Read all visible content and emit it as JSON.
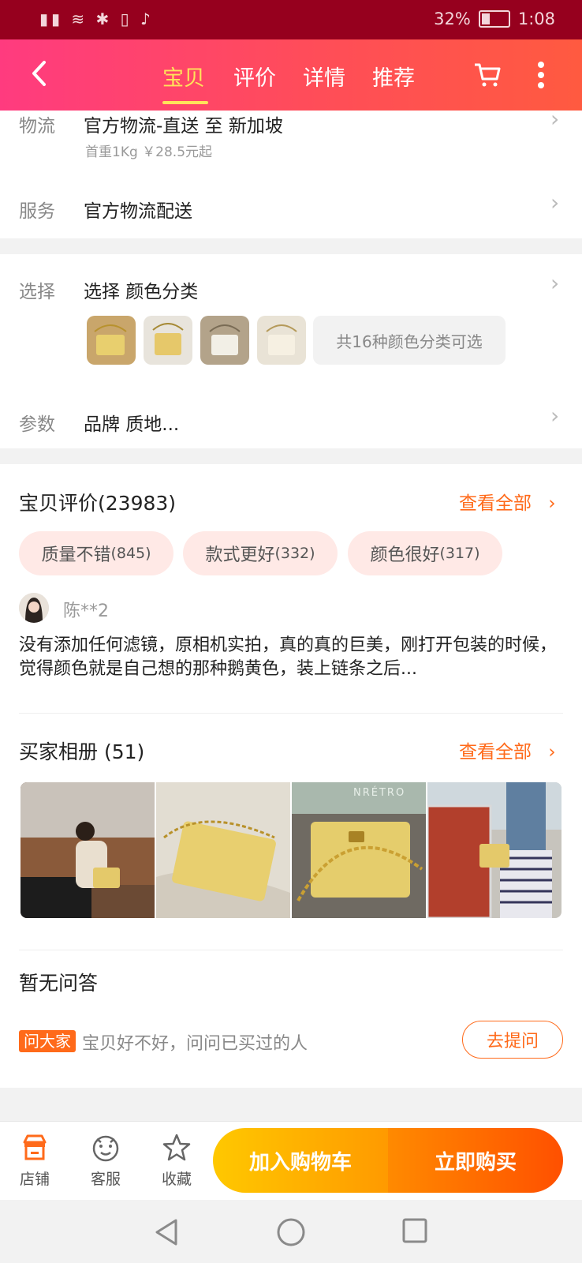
{
  "status_bar": {
    "signals": "▮▮ ≋ ✱ ▯ ♪",
    "battery": "32%",
    "time": "1:08"
  },
  "header": {
    "back_icon": "chevron-left-icon",
    "tabs": [
      "宝贝",
      "评价",
      "详情",
      "推荐"
    ],
    "active_tab": 0,
    "accent_color": "#ffe35a",
    "gradient": [
      "#ff3b7f",
      "#ff5a40"
    ]
  },
  "shipping": {
    "label": "物流",
    "value": "官方物流-直送 至 新加坡",
    "sub": "首重1Kg ￥28.5元起"
  },
  "service": {
    "label": "服务",
    "value": "官方物流配送"
  },
  "select": {
    "label": "选择",
    "value": "选择 颜色分类",
    "more": "共16种颜色分类可选"
  },
  "params": {
    "label": "参数",
    "value": "品牌 质地..."
  },
  "reviews": {
    "title": "宝贝评价(23983)",
    "see_all": "查看全部",
    "tags": [
      {
        "text": "质量不错",
        "count": "(845)"
      },
      {
        "text": "款式更好",
        "count": "(332)"
      },
      {
        "text": "颜色很好",
        "count": "(317)"
      }
    ],
    "reviewer": "陈**2",
    "text": "没有添加任何滤镜，原相机实拍，真的真的巨美，刚打开包装的时候，觉得颜色就是自己想的那种鹅黄色，装上链条之后..."
  },
  "album": {
    "title": "买家相册 (51)",
    "see_all": "查看全部",
    "photo_brand_text": "NRÉTRO"
  },
  "qa": {
    "title": "暂无问答",
    "badge": "问大家",
    "prompt": "宝贝好不好，问问已买过的人",
    "button": "去提问"
  },
  "bottom_bar": {
    "shop": "店铺",
    "service": "客服",
    "favorite": "收藏",
    "add_to_cart": "加入购物车",
    "buy_now": "立即购买"
  }
}
